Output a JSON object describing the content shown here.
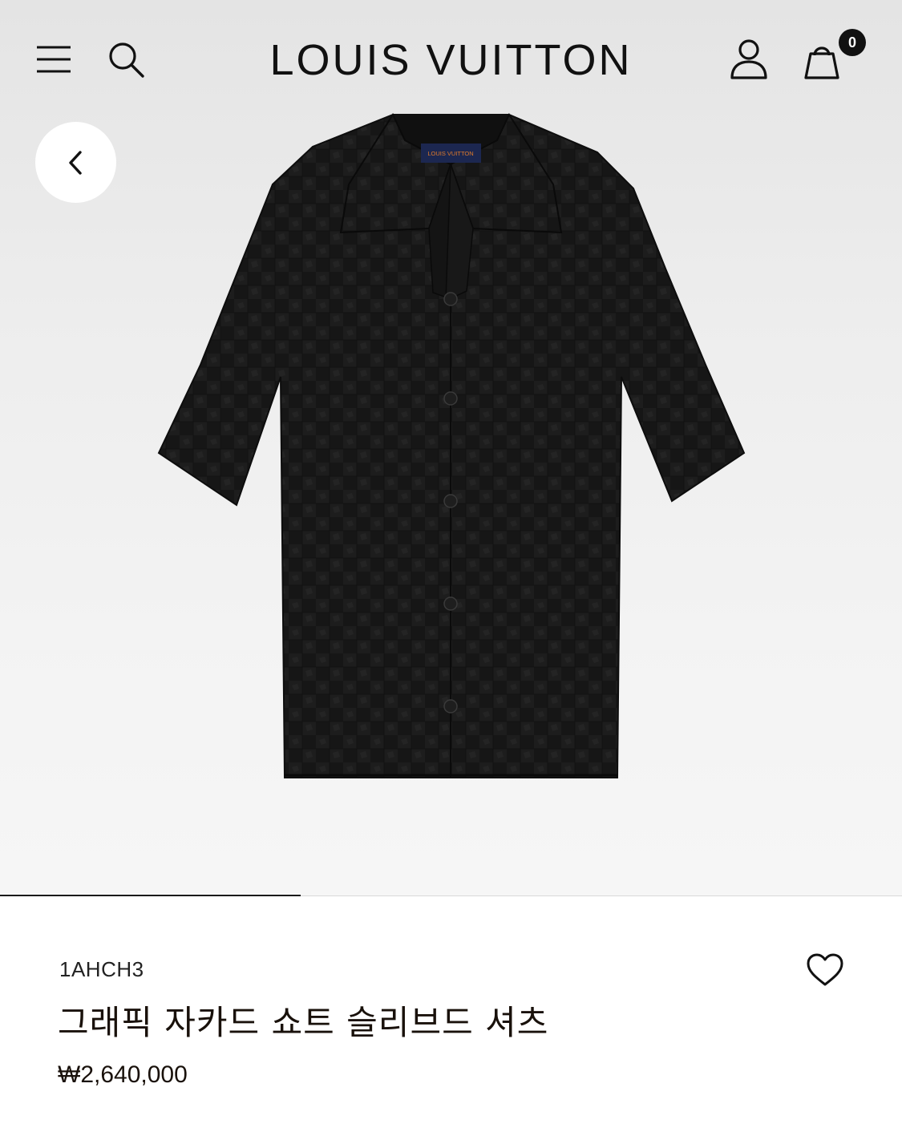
{
  "header": {
    "brand": "LOUIS VUITTON",
    "bag_count": "0",
    "icons": {
      "menu": "menu-icon",
      "search": "search-icon",
      "account": "user-icon",
      "bag": "shopping-bag-icon",
      "back": "chevron-left-icon",
      "wishlist": "heart-icon"
    }
  },
  "product": {
    "label_text": "LOUIS VUITTON",
    "sku": "1AHCH3",
    "name": "그래픽 자카드 쇼트 슬리브드 셔츠",
    "price": "₩2,640,000"
  },
  "gallery": {
    "progress_fraction": 0.333
  },
  "colors": {
    "text": "#19110b",
    "label_accent": "#e07b2a",
    "label_bg": "#1c2750"
  }
}
